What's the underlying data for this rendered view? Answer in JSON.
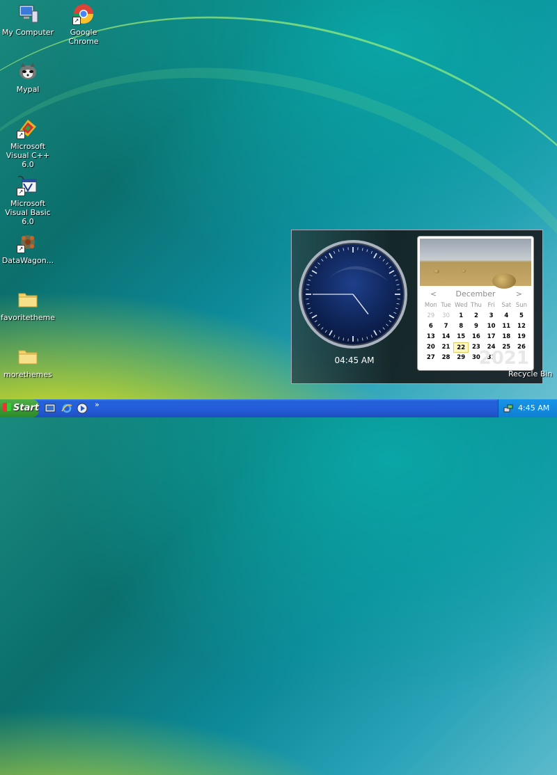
{
  "desktop": {
    "icons": [
      {
        "label": "My Computer"
      },
      {
        "label": "Google Chrome"
      },
      {
        "label": "Mypal"
      },
      {
        "label": "Microsoft Visual C++ 6.0"
      },
      {
        "label": "Microsoft Visual Basic 6.0"
      },
      {
        "label": "DataWagon..."
      },
      {
        "label": "favoritetheme"
      },
      {
        "label": "morethemes"
      },
      {
        "label": "Recycle Bin"
      }
    ]
  },
  "clock_widget": {
    "time": "04:45 AM",
    "hour": 4,
    "minute": 45
  },
  "calendar_widget": {
    "month": "December",
    "year": "2021",
    "prev": "<",
    "next": ">",
    "weekdays": [
      "Mon",
      "Tue",
      "Wed",
      "Thu",
      "Fri",
      "Sat",
      "Sun"
    ],
    "weeks": [
      [
        "29",
        "30",
        "1",
        "2",
        "3",
        "4",
        "5"
      ],
      [
        "6",
        "7",
        "8",
        "9",
        "10",
        "11",
        "12"
      ],
      [
        "13",
        "14",
        "15",
        "16",
        "17",
        "18",
        "19"
      ],
      [
        "20",
        "21",
        "22",
        "23",
        "24",
        "25",
        "26"
      ],
      [
        "27",
        "28",
        "29",
        "30",
        "31",
        "",
        ""
      ]
    ],
    "other_month_days": [
      "29",
      "30"
    ],
    "today": "22"
  },
  "taskbar": {
    "start_label": "Start",
    "chevron": "»",
    "clock": "4:45 AM"
  },
  "colors": {
    "taskbar_blue": "#245edb",
    "start_green": "#3a9a35",
    "tray_blue": "#0f7fd4"
  }
}
